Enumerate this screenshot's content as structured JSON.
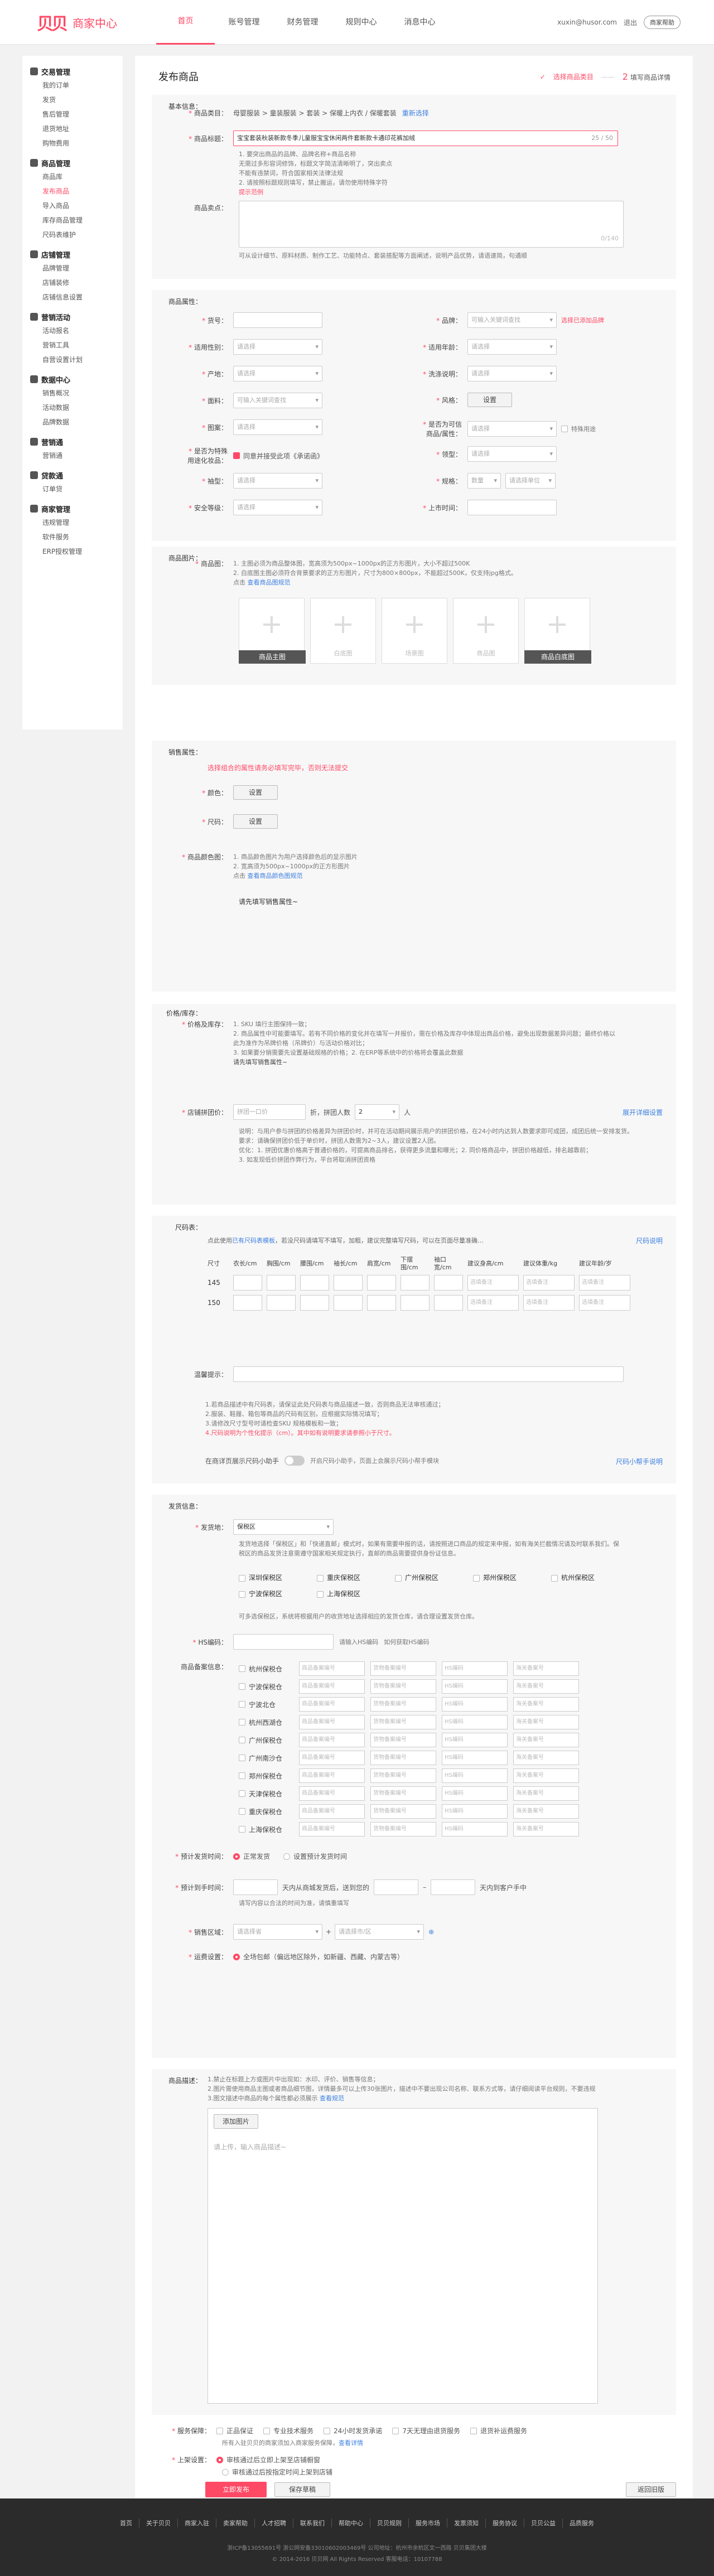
{
  "header": {
    "logo_mark": "贝贝",
    "logo_text": "商家中心",
    "nav": [
      "首页",
      "账号管理",
      "财务管理",
      "规则中心",
      "消息中心"
    ],
    "user": "xuxin@husor.com",
    "logout": "退出",
    "help": "商家帮助"
  },
  "sidebar": [
    {
      "title": "交易管理",
      "items": [
        "我的订单",
        "发货",
        "售后管理",
        "退货地址",
        "购物费用"
      ]
    },
    {
      "title": "商品管理",
      "items": [
        "商品库",
        "发布商品",
        "导入商品",
        "库存商品管理",
        "尺码表维护"
      ]
    },
    {
      "title": "店铺管理",
      "items": [
        "品牌管理",
        "店铺装修",
        "店铺信息设置"
      ]
    },
    {
      "title": "营销活动",
      "items": [
        "活动报名",
        "营销工具",
        "自营设置计划"
      ]
    },
    {
      "title": "数据中心",
      "items": [
        "销售概况",
        "活动数据",
        "品牌数据"
      ]
    },
    {
      "title": "营销通",
      "items": [
        "营销通"
      ]
    },
    {
      "title": "贷款通",
      "items": [
        "订单贷"
      ]
    },
    {
      "title": "商家管理",
      "items": [
        "违规管理",
        "软件服务",
        "ERP授权管理"
      ]
    }
  ],
  "page": {
    "title": "发布商品",
    "step1": "选择商品类目",
    "step2_num": "2",
    "step2": "填写商品详情"
  },
  "basic": {
    "section": "基本信息：",
    "category_label": "商品类目：",
    "category_value": "母婴服装 > 童装服装 > 套装 > 保暖上内衣 / 保暖套装",
    "reselect": "重新选择",
    "title_label": "商品标题：",
    "title_value": "宝宝套装秋装新款冬季儿童服宝宝休闲两件套新款卡通印花裤加绒",
    "title_count": "25 / 50",
    "title_notes": [
      "1. 要突出商品的品牌、品牌名称+商品名称",
      "   无需过多形容词修饰，标题文字简洁清晰明了，突出卖点",
      "   不能有违禁词，符合国家相关法律法规",
      "2. 请按照标题规则填写，禁止搬运，请勿使用特殊字符"
    ],
    "title_link": "提示范例",
    "sellpoint_label": "商品卖点：",
    "sellpoint_count": "0/140",
    "sellpoint_note": "可从设计细节、原料材质、制作工艺、功能特点、套装搭配等方面阐述，说明产品优势，请语速简，句通顺"
  },
  "attrs": {
    "section": "商品属性：",
    "fields": [
      {
        "label": "货号：",
        "ph": ""
      },
      {
        "label": "品牌：",
        "ph": "可输入关键词查找",
        "link": "选择已添加品牌"
      },
      {
        "label": "适用性别：",
        "ph": "请选择"
      },
      {
        "label": "适用年龄：",
        "ph": "请选择"
      },
      {
        "label": "产地：",
        "ph": "请选择"
      },
      {
        "label": "洗涤说明：",
        "ph": "请选择"
      },
      {
        "label": "面料：",
        "ph": "可输入关键词查找"
      },
      {
        "label": "风格：",
        "btn": "设置"
      },
      {
        "label": "图案：",
        "ph": "请选择"
      },
      {
        "label": "是否为可信商品/属性：",
        "ph": "请选择",
        "extra": "特殊用途"
      },
      {
        "label": "是否为特殊用途化妆品：",
        "check": "同意并接受此项《承诺函》"
      },
      {
        "label": "领型：",
        "ph": "请选择"
      },
      {
        "label": "袖型：",
        "ph": "请选择"
      },
      {
        "label": "规格：",
        "ph": "数量",
        "ph2": "请选择单位"
      },
      {
        "label": "安全等级：",
        "ph": "请选择"
      },
      {
        "label": "上市时间：",
        "ph": ""
      }
    ]
  },
  "images": {
    "section": "商品图片：",
    "label": "商品图：",
    "notes": [
      "1. 主图必须为商品整体图，宽高须为500px~1000px的正方形图片，大小不超过500K",
      "2. 白底图主图必须符合背景要求的正方形图片，尺寸为800×800px，不能超过500K，仅支持jpg格式。"
    ],
    "link_prefix": "点击",
    "link": "查看商品图规范",
    "boxes": [
      "商品主图",
      "白底图",
      "场景图",
      "商品图",
      "商品白底图"
    ]
  },
  "sales": {
    "section": "销售属性：",
    "warn": "选择组合的属性请务必填写完毕，否则无法提交",
    "color": "颜色：",
    "size": "尺码：",
    "set": "设置",
    "colorimg_label": "商品颜色图：",
    "colorimg_notes": [
      "1. 商品颜色图片为用户选择颜色后的显示图片",
      "2. 宽高须为500px~1000px的正方形图片"
    ],
    "colorimg_link_prefix": "点击",
    "colorimg_link": "查看商品颜色图规范",
    "fill_prompt": "请先填写销售属性~"
  },
  "stock": {
    "section": "价格/库存：",
    "label": "价格及库存：",
    "notes": [
      "1. SKU 填行主图保持一致；",
      "2. 商品属性中可能要填写。若有不同价格的变化并在填写一并报价，需在价格及库存中体现出商品价格，避免出现数据差异问题；最终价格以此为准作为吊牌价格（吊牌价）与活动价格对比；",
      "3. 如果要分销需要先设置基础规格的价格；2. 在ERP等系统中的价格将会覆盖此数据"
    ],
    "link": "请先填写销售属性~",
    "group_label": "店铺拼团价：",
    "group_ph": "拼团一口价",
    "group_unit": "折，拼团人数",
    "group_count": "2",
    "group_people": "人",
    "group_link": "展开详细设置",
    "group_notes": [
      "说明：与用户参与拼团的价格差异为拼团价时，并可在活动期间展示用户的拼团价格，在24小时内达到人数要求即可成团，成团后统一安排发货。",
      "要求：请确保拼团价低于单价时，拼团人数需为2~3人，建议设置2人团。",
      "优化：1. 拼团优惠价格高于普通价格的，可提高商品排名，获得更多流量和曝光；2. 同价格商品中，拼团价格越低，排名越靠前；",
      "      3. 如发现低价拼团作弊行为，平台将取消拼团资格"
    ]
  },
  "sizetable": {
    "section": "尺码表：",
    "hint_prefix": "点此使用",
    "hint_link": "已有尺码表模板",
    "hint_rest": "，若没尺码请填写不填写，加粗，建议完整填写尺码，可以在页面尽量准确…",
    "hint_right": "尺码说明",
    "cols": [
      "尺寸",
      "衣长/cm",
      "胸围/cm",
      "腰围/cm",
      "袖长/cm",
      "肩宽/cm",
      "下摆围/cm",
      "袖口宽/cm",
      "建议身高/cm",
      "建议体重/kg",
      "建议年龄/岁"
    ],
    "rows": [
      {
        "size": "145",
        "ph1": "选填备注",
        "ph2": "选填备注",
        "ph3": "选填备注"
      },
      {
        "size": "150",
        "ph1": "选填备注",
        "ph2": "选填备注",
        "ph3": "选填备注"
      }
    ],
    "tip_label": "温馨提示：",
    "rules": [
      "1.若商品描述中有尺码表，请保证此处尺码表与商品描述一致，否则商品无法审核通过；",
      "2.服装、鞋履、箱包等商品的尺码有区别，应根据实际情况填写；",
      "3.请修改尺寸型号时请检查SKU 规格模板和一致；",
      "4.尺码说明为个性化提示（cm）。其中如有说明要求请参照小于尺寸。"
    ],
    "auto_label": "在商详页展示尺码小助手",
    "auto_desc": "开启尺码小助手，页面上会展示尺码小帮手模块",
    "auto_link": "尺码小帮手说明"
  },
  "shipping": {
    "section": "发货信息：",
    "warehouse_label": "发货地：",
    "warehouse_value": "保税区",
    "warehouse_note": "发货地选择「保税区」和「快递直邮」模式时，如果有需要申报的话，请按照进口商品的规定来申报，如有海关拦截情况请及时联系我们。保税区的商品发货注意需遵守国家相关规定执行，直邮的商品需要提供身份证信息。",
    "zones": [
      "深圳保税区",
      "重庆保税区",
      "广州保税区",
      "郑州保税区",
      "杭州保税区",
      "宁波保税区",
      "上海保税区"
    ],
    "zone_note": "可多选保税区，系统将根据用户的收货地址选择相应的发货仓库，请合理设置发货仓库。",
    "hs_label": "HS编码：",
    "hs_note1": "请输入HS编码",
    "hs_note2": "如何获取HS编码",
    "ware_label": "商品备案信息：",
    "warehouses": [
      "杭州保税仓",
      "宁波保税仓",
      "宁波北仓",
      "杭州西湖仓",
      "广州保税仓",
      "广州南沙仓",
      "郑州保税仓",
      "天津保税仓",
      "重庆保税仓",
      "上海保税仓"
    ],
    "ware_ph": [
      "商品备案编号",
      "货物备案编号",
      "HS编码",
      "海关备案号"
    ],
    "time_label": "预计发货时间：",
    "time_opt1": "正常发货",
    "time_opt2": "设置预计发货时间",
    "arrive_label": "预计到手时间：",
    "arrive_ph": "",
    "arrive_mid": "天内从商城发货后，送到您的",
    "arrive_tail": "天内到客户手中",
    "arrive_note": "请写内容以合法的时间为准，请慎重填写",
    "sale_label": "销售区域：",
    "sale_ph1": "请选择省",
    "sale_ph2": "请选择市/区",
    "fee_label": "运费设置：",
    "fee_value": "全场包邮（偏远地区除外，如新疆、西藏、内蒙古等）"
  },
  "desc": {
    "section": "商品描述：",
    "notes": [
      "1.禁止在标题上方或图片中出现如：水印、评价、销售等信息；",
      "2.图片需使用商品主图或者商品细节图，详情最多可以上传30张图片，描述中不要出现公司名称、联系方式等，请仔细阅读平台规则，不要违规",
      "3.图文描述中商品的每个属性都必须展示"
    ],
    "link": "查看规范",
    "add_btn": "添加图片",
    "placeholder": "请上传，输入商品描述~"
  },
  "service": {
    "label": "服务保障：",
    "opts": [
      "正品保证",
      "专业技术服务",
      "24小时发货承诺",
      "7天无理由退货服务",
      "退货补运费服务"
    ],
    "note": "所有入驻贝贝的商家须加入商家服务保障，",
    "link": "查看详情"
  },
  "shelf": {
    "label": "上架设置：",
    "opt1": "审核通过后立即上架至店铺橱窗",
    "opt2": "审核通过后按指定时间上架到店铺"
  },
  "actions": {
    "submit": "立即发布",
    "draft": "保存草稿",
    "back": "返回旧版"
  },
  "footer": {
    "links": [
      "首页",
      "关于贝贝",
      "商家入驻",
      "卖家帮助",
      "人才招聘",
      "联系我们",
      "帮助中心",
      "贝贝规则",
      "服务市场",
      "发票须知",
      "服务协议",
      "贝贝公益",
      "品质服务"
    ],
    "line1": "浙ICP备13055691号  浙公网安备33010602003469号  公司地址：杭州市余杭区文一西路 贝贝集团大楼",
    "line2": "© 2014-2016 贝贝网 All Rights Reserved   客服电话：10107788"
  }
}
